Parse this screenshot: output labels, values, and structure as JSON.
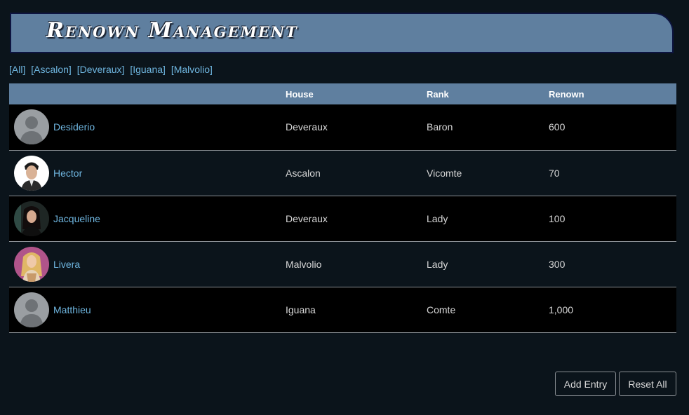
{
  "header": {
    "title": "Renown Management"
  },
  "filters": [
    "[All]",
    "[Ascalon]",
    "[Deveraux]",
    "[Iguana]",
    "[Malvolio]"
  ],
  "table": {
    "columns": [
      "",
      "House",
      "Rank",
      "Renown"
    ],
    "rows": [
      {
        "name": "Desiderio",
        "house": "Deveraux",
        "rank": "Baron",
        "renown": "600",
        "avatar": "placeholder-silhouette"
      },
      {
        "name": "Hector",
        "house": "Ascalon",
        "rank": "Vicomte",
        "renown": "70",
        "avatar": "photo-man"
      },
      {
        "name": "Jacqueline",
        "house": "Deveraux",
        "rank": "Lady",
        "renown": "100",
        "avatar": "photo-woman-dark"
      },
      {
        "name": "Livera",
        "house": "Malvolio",
        "rank": "Lady",
        "renown": "300",
        "avatar": "photo-woman-blonde"
      },
      {
        "name": "Matthieu",
        "house": "Iguana",
        "rank": "Comte",
        "renown": "1,000",
        "avatar": "placeholder-silhouette"
      }
    ]
  },
  "buttons": {
    "add": "Add Entry",
    "reset": "Reset All"
  },
  "colors": {
    "accent": "#5f7f9f",
    "link": "#6fb6e0",
    "background": "#0b141b"
  }
}
